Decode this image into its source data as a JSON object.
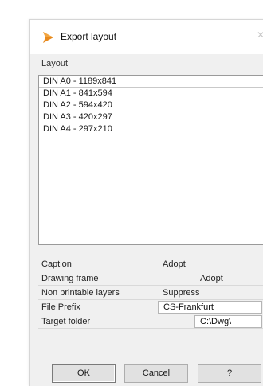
{
  "dialog": {
    "title": "Export layout",
    "layout_label": "Layout",
    "layouts": [
      "DIN A0 - 1189x841",
      "DIN A1 - 841x594",
      "DIN A2 - 594x420",
      "DIN A3 - 420x297",
      "DIN A4 - 297x210"
    ],
    "properties": {
      "caption": {
        "label": "Caption",
        "value": "Adopt"
      },
      "drawing_frame": {
        "label": "Drawing frame",
        "value": "Adopt"
      },
      "non_printable_layers": {
        "label": "Non printable layers",
        "value": "Suppress"
      },
      "file_prefix": {
        "label": "File Prefix",
        "value": "CS-Frankfurt"
      },
      "target_folder": {
        "label": "Target folder",
        "value": "C:\\Dwg\\"
      }
    },
    "buttons": {
      "ok": "OK",
      "cancel": "Cancel",
      "help": "?"
    },
    "colors": {
      "icon_orange": "#e8891c",
      "icon_dark": "#a85a08"
    }
  }
}
